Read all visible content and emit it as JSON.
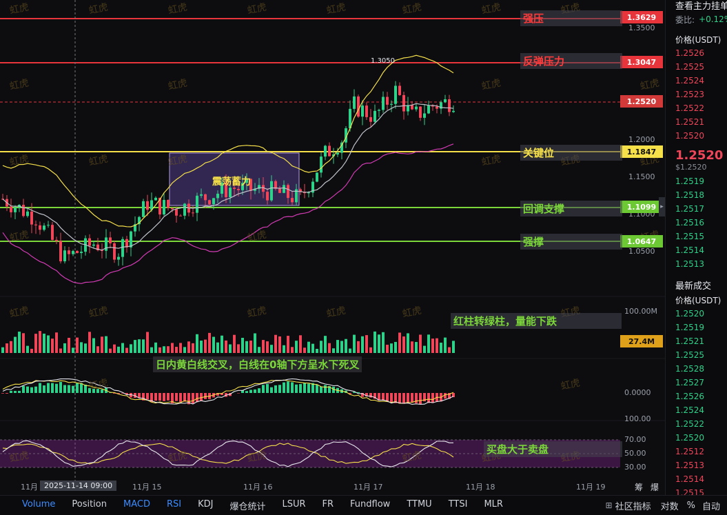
{
  "chart": {
    "price_axis": [
      "1.3500",
      "1.2000",
      "1.1500",
      "1.1000",
      "1.0500"
    ],
    "volume_axis": [
      "100.00M"
    ],
    "volume_badge": "27.4M",
    "macd_axis": [
      "0.0000"
    ],
    "rsi_axis": [
      "100.00",
      "70.00",
      "50.00",
      "30.00"
    ],
    "high_marker": "1.3050",
    "x_ticks": [
      "11月",
      "11月 15",
      "11月 16",
      "11月 17",
      "11月 18",
      "11月 19"
    ],
    "crosshair_time": "2025-11-14 09:00",
    "watermark": "虹虎"
  },
  "levels": [
    {
      "label": "强压",
      "price": "1.3629",
      "color": "#e8343b"
    },
    {
      "label": "反弹压力",
      "price": "1.3047",
      "color": "#e8343b"
    },
    {
      "label": "",
      "price": "1.2520",
      "color": "#e8343b"
    },
    {
      "label": "关键位",
      "price": "1.1847",
      "color": "#f5e04a"
    },
    {
      "label": "回调支撑",
      "price": "1.1099",
      "color": "#7bd63a"
    },
    {
      "label": "强撑",
      "price": "1.0647",
      "color": "#7bd63a"
    }
  ],
  "annotations": {
    "range_box": "震荡蓄力",
    "volume_note": "红柱转绿柱，量能下跌",
    "macd_note": "日内黄白线交叉，白线在0轴下方呈水下死叉",
    "rsi_note": "买盘大于卖盘"
  },
  "right_panel": {
    "header": "查看主力挂单",
    "weibi_label": "委比:",
    "weibi_value": "+0.12%",
    "price_header": "价格(USDT)",
    "asks": [
      "1.2526",
      "1.2525",
      "1.2524",
      "1.2523",
      "1.2522",
      "1.2521",
      "1.2520"
    ],
    "last_price": "1.2520",
    "last_price_usd": "$1.2520",
    "bids": [
      "1.2519",
      "1.2518",
      "1.2517",
      "1.2516",
      "1.2515",
      "1.2514",
      "1.2513"
    ],
    "trades_title": "最新成交",
    "trades_header": "价格(USDT)",
    "trades": [
      {
        "p": "1.2520",
        "c": "#2fd28a"
      },
      {
        "p": "1.2519",
        "c": "#2fd28a"
      },
      {
        "p": "1.2521",
        "c": "#2fd28a"
      },
      {
        "p": "1.2525",
        "c": "#2fd28a"
      },
      {
        "p": "1.2528",
        "c": "#2fd28a"
      },
      {
        "p": "1.2527",
        "c": "#2fd28a"
      },
      {
        "p": "1.2526",
        "c": "#2fd28a"
      },
      {
        "p": "1.2524",
        "c": "#2fd28a"
      },
      {
        "p": "1.2522",
        "c": "#2fd28a"
      },
      {
        "p": "1.2520",
        "c": "#2fd28a"
      },
      {
        "p": "1.2512",
        "c": "#f0465a"
      },
      {
        "p": "1.2513",
        "c": "#f0465a"
      },
      {
        "p": "1.2514",
        "c": "#f0465a"
      },
      {
        "p": "1.2515",
        "c": "#f0465a"
      }
    ]
  },
  "bottom_tabs": [
    "Volume",
    "Position",
    "MACD",
    "RSI",
    "KDJ",
    "爆仓统计",
    "LSUR",
    "FR",
    "Fundflow",
    "TTMU",
    "TTSI",
    "MLR"
  ],
  "bottom_right": [
    "社区指标",
    "对数",
    "%",
    "自动"
  ],
  "corner": [
    "筹",
    "爆"
  ],
  "colors": {
    "up": "#2fd28a",
    "down": "#f0465a",
    "accent": "#3b8cff"
  }
}
